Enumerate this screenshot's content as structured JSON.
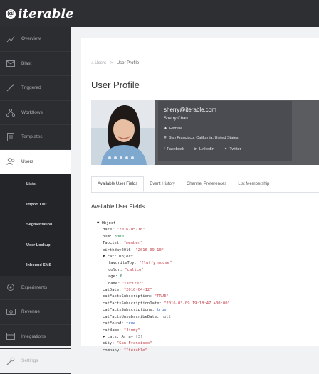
{
  "app": {
    "logo_text": "iterable",
    "logo_mark": "@"
  },
  "sidebar": {
    "items": [
      {
        "label": "Overview",
        "icon": "chart-line-icon"
      },
      {
        "label": "Blast",
        "icon": "envelope-icon"
      },
      {
        "label": "Triggered",
        "icon": "wand-icon"
      },
      {
        "label": "Workflows",
        "icon": "flow-icon"
      },
      {
        "label": "Templates",
        "icon": "template-icon"
      },
      {
        "label": "Users",
        "icon": "users-icon",
        "active": true
      }
    ],
    "subitems": [
      "Lists",
      "Import List",
      "Segmentation",
      "User Lookup",
      "Inbound SMS"
    ],
    "items_after": [
      {
        "label": "Experiments",
        "icon": "experiment-icon"
      },
      {
        "label": "Revenue",
        "icon": "revenue-icon"
      },
      {
        "label": "Integrations",
        "icon": "integrations-icon"
      },
      {
        "label": "Settings",
        "icon": "settings-icon"
      }
    ]
  },
  "breadcrumb": {
    "parent": "Users",
    "separator": ">",
    "current": "User Profile"
  },
  "page": {
    "title": "User Profile"
  },
  "profile": {
    "email": "sherry@iterable.com",
    "name": "Sherry Chao",
    "gender": "Female",
    "location": "San Francisco, California, United States",
    "social": {
      "facebook": "Facebook",
      "linkedin": "LinkedIn",
      "twitter": "Twitter"
    }
  },
  "tabs": [
    "Available User Fields",
    "Event History",
    "Channel Preferences",
    "List Membership"
  ],
  "fields_section": {
    "title": "Available User Fields"
  },
  "object_view": {
    "root": "▼ Object",
    "lines": [
      {
        "key": "date:",
        "val": "\"2016-05-16\"",
        "type": "s",
        "indent": 1
      },
      {
        "key": "num:",
        "val": "3000",
        "type": "n",
        "indent": 1
      },
      {
        "key": "TwoList:",
        "val": "\"member\"",
        "type": "s",
        "indent": 1
      },
      {
        "key": "birthday2016:",
        "val": "\"2016-09-10\"",
        "type": "s",
        "indent": 1
      },
      {
        "key": "▼ cat: Object",
        "val": "",
        "type": "k",
        "indent": 1
      },
      {
        "key": "favoriteToy:",
        "val": "\"fluffy mouse\"",
        "type": "s",
        "indent": 2
      },
      {
        "key": "color:",
        "val": "\"calico\"",
        "type": "s",
        "indent": 2
      },
      {
        "key": "age:",
        "val": "6",
        "type": "n",
        "indent": 2
      },
      {
        "key": "name:",
        "val": "\"Lucifer\"",
        "type": "s",
        "indent": 2
      },
      {
        "key": "catDate:",
        "val": "\"2016-04-12\"",
        "type": "s",
        "indent": 1
      },
      {
        "key": "catFactsSubscription:",
        "val": "\"TRUE\"",
        "type": "s",
        "indent": 1
      },
      {
        "key": "catFactsSubscriptionDate:",
        "val": "\"2016-03-09 19:18:47 +00:00\"",
        "type": "s",
        "indent": 1
      },
      {
        "key": "catFactsSubscriptions:",
        "val": "true",
        "type": "b",
        "indent": 1
      },
      {
        "key": "catFactsUnsubscribeDate:",
        "val": "null",
        "type": "d",
        "indent": 1
      },
      {
        "key": "catFound:",
        "val": "true",
        "type": "b",
        "indent": 1
      },
      {
        "key": "catName:",
        "val": "\"Jimmy\"",
        "type": "s",
        "indent": 1
      },
      {
        "key": "▶ cats: Array",
        "val": "[3]",
        "type": "d",
        "indent": 1
      },
      {
        "key": "city:",
        "val": "\"San Francisco\"",
        "type": "s",
        "indent": 1
      },
      {
        "key": "company:",
        "val": "\"Iterable\"",
        "type": "s",
        "indent": 1
      }
    ]
  }
}
